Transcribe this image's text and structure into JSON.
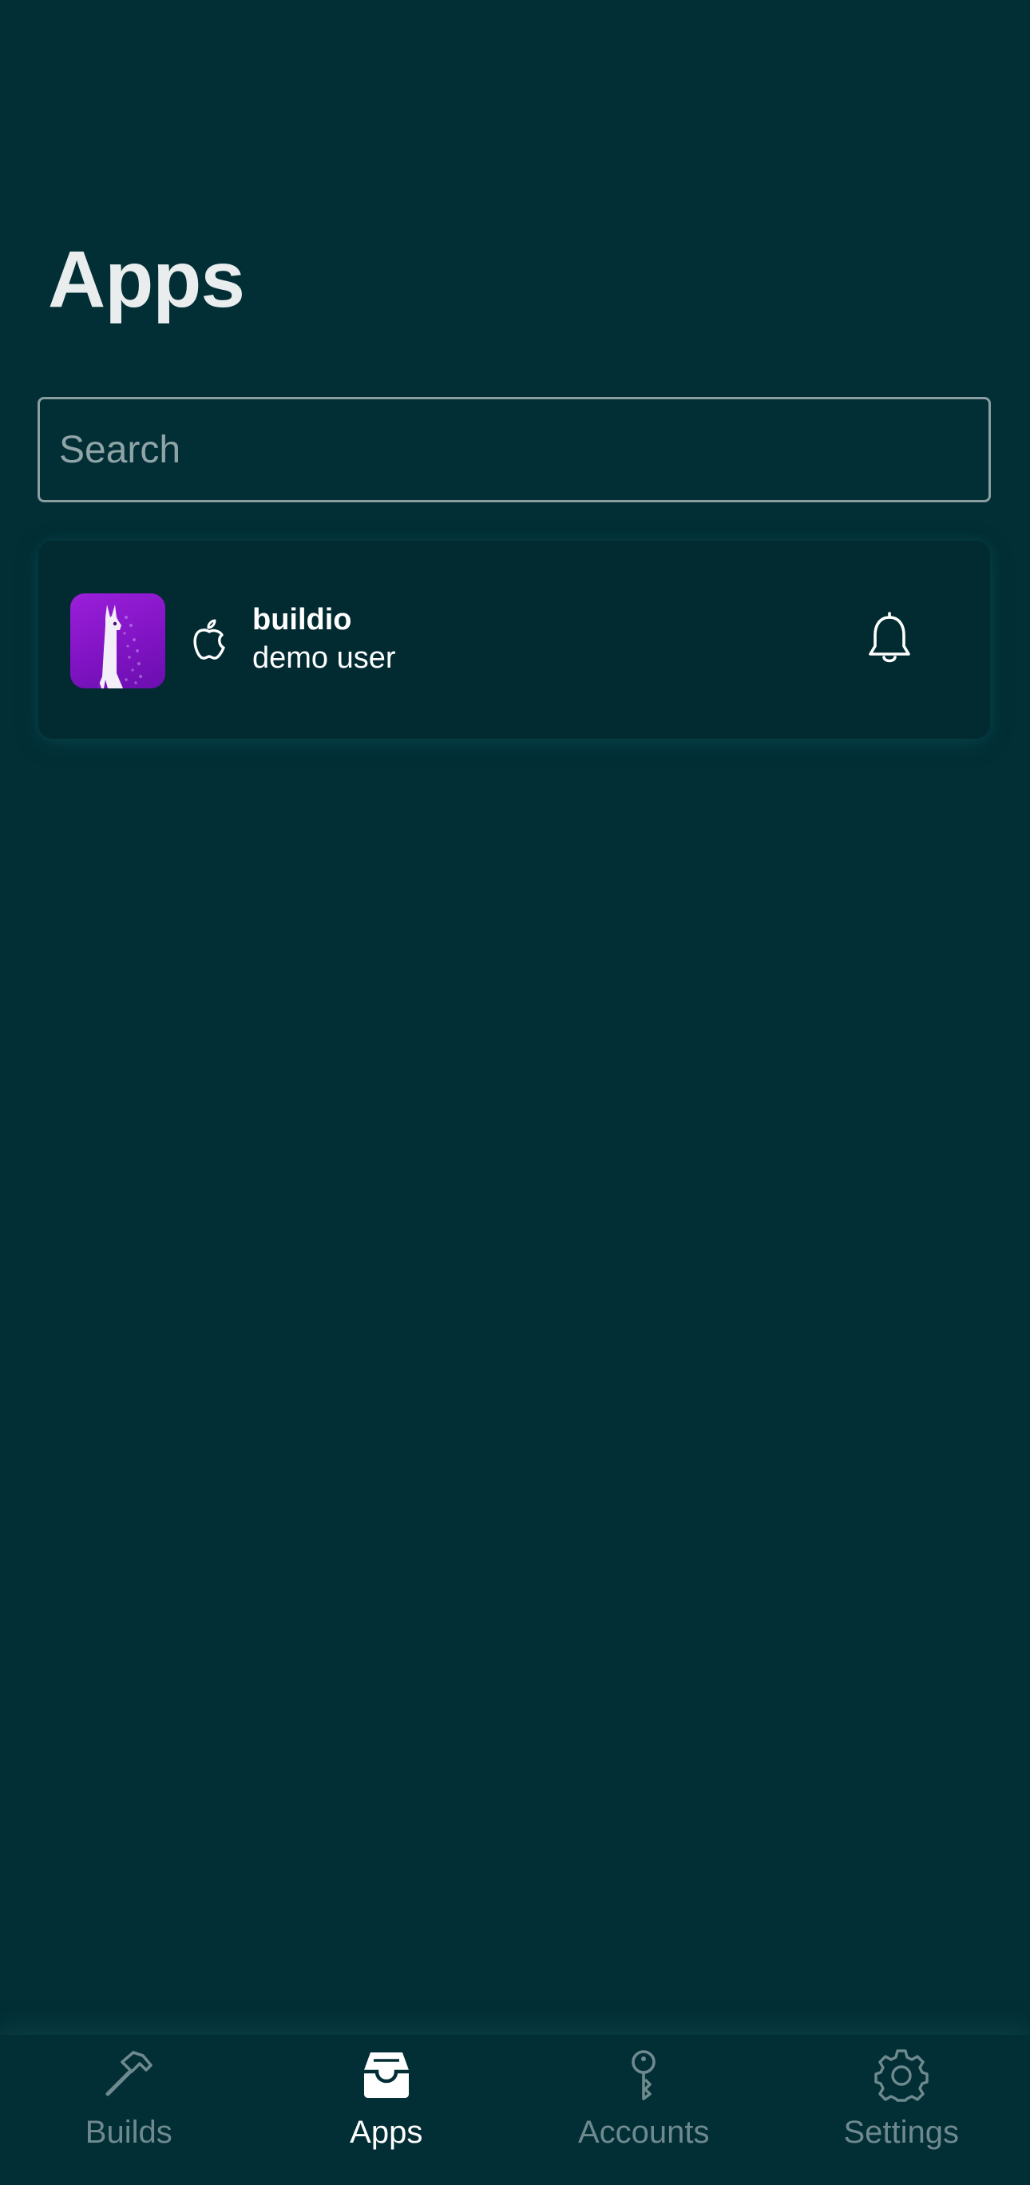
{
  "header": {
    "title": "Apps"
  },
  "search": {
    "placeholder": "Search",
    "value": ""
  },
  "apps": [
    {
      "name": "buildio",
      "owner": "demo user",
      "platform": "apple-icon",
      "icon": "llama-app-icon",
      "notification_icon": "bell-icon"
    }
  ],
  "tab_bar": {
    "tabs": [
      {
        "label": "Builds",
        "icon": "hammer-icon",
        "active": false
      },
      {
        "label": "Apps",
        "icon": "inbox-tray-icon",
        "active": true
      },
      {
        "label": "Accounts",
        "icon": "key-icon",
        "active": false
      },
      {
        "label": "Settings",
        "icon": "gear-icon",
        "active": false
      }
    ]
  },
  "colors": {
    "background": "#022e35",
    "card": "#012a31",
    "app_icon_accent": "#8e18cc",
    "inactive_tab": "#6f8a8e",
    "active_tab": "#ffffff"
  }
}
